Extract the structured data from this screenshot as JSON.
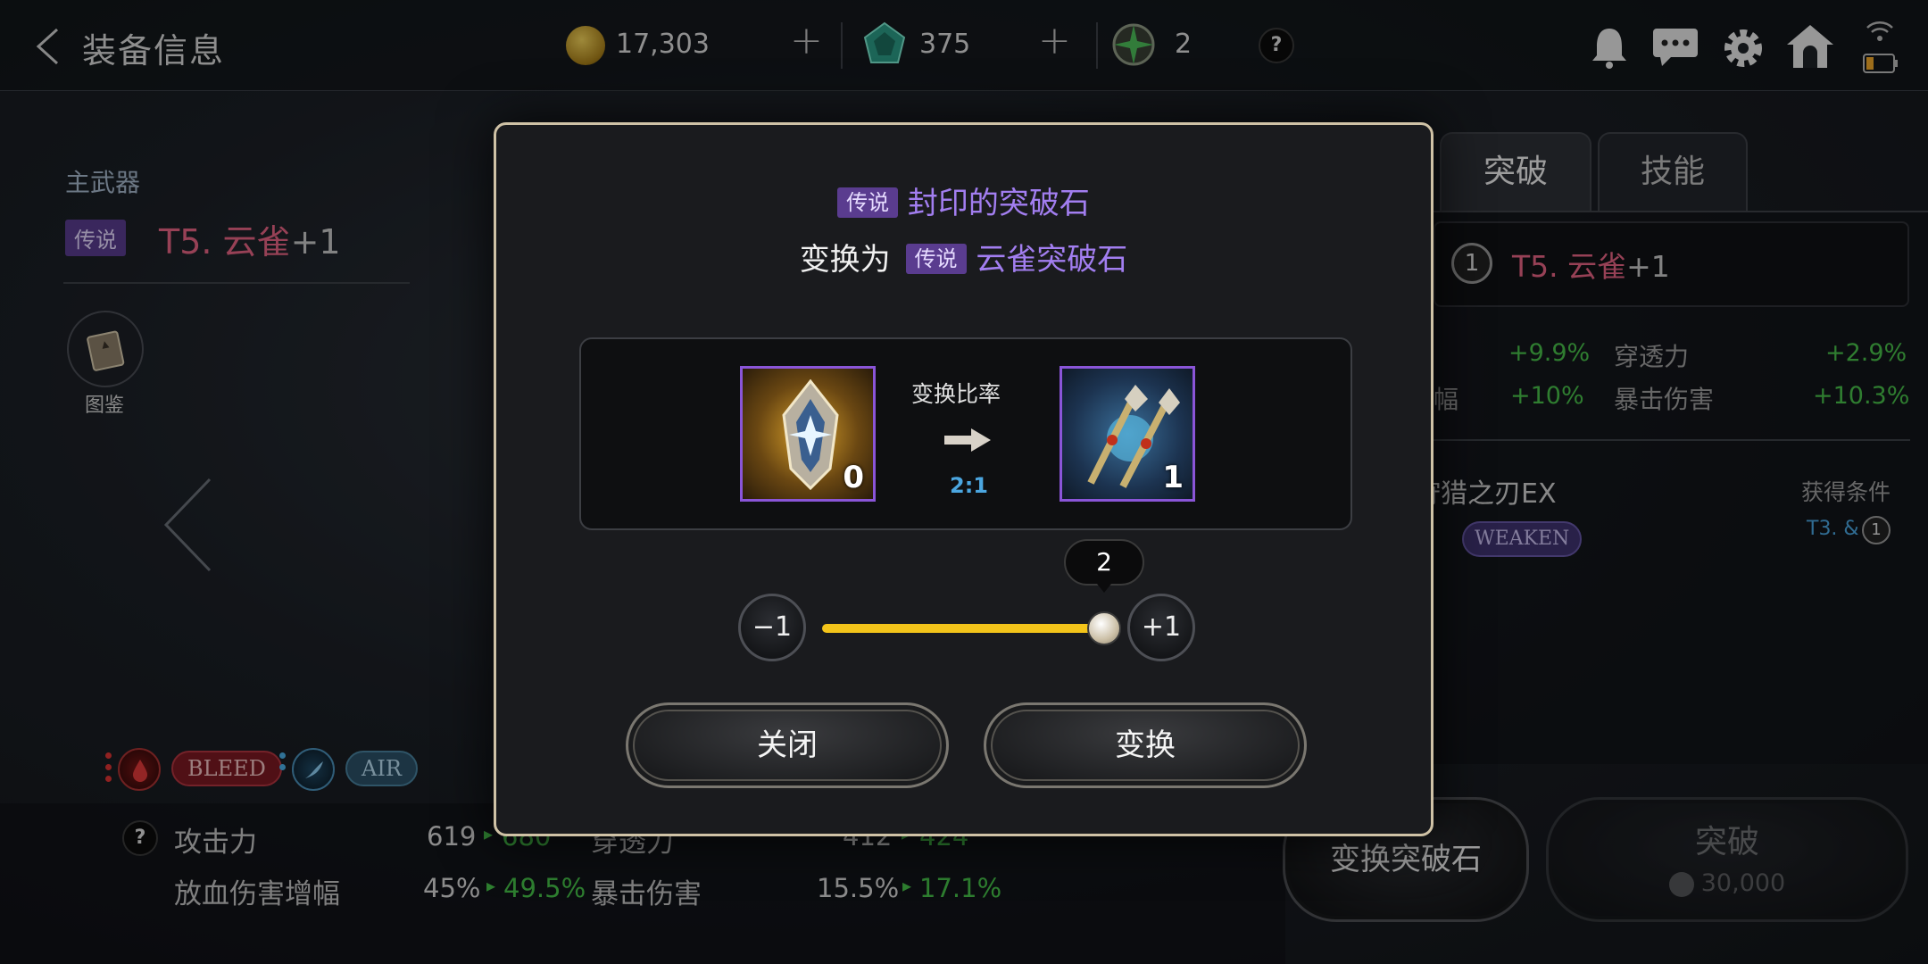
{
  "header": {
    "title": "装备信息",
    "gold": "17,303",
    "gems": "375",
    "tokens": "2",
    "help": "?",
    "plus": "+"
  },
  "left": {
    "slot_label": "主武器",
    "rarity": "传说",
    "weapon_name": "T5. 云雀",
    "weapon_level": "+1",
    "codex_label": "图鉴",
    "chips": [
      "BLEED",
      "AIR"
    ]
  },
  "stats": {
    "help": "?",
    "rows": [
      {
        "label": "攻击力",
        "value": "619",
        "new": "680",
        "label2": "穿透力",
        "value2": "412",
        "new2": "424"
      },
      {
        "label": "放血伤害增幅",
        "value": "45%",
        "new": "49.5%",
        "label2": "暴击伤害",
        "value2": "15.5%",
        "new2": "17.1%"
      }
    ]
  },
  "right": {
    "tabs": [
      "突破",
      "技能"
    ],
    "item_badge": "1",
    "item_name": "T5. 云雀",
    "item_level": "+1",
    "stats": [
      {
        "v1": "+9.9%",
        "label": "穿透力",
        "v2": "+2.9%"
      },
      {
        "label_left": "幅",
        "v1": "+10%",
        "label": "暴击伤害",
        "v2": "+10.3%"
      }
    ],
    "skill_name": "狩猎之刃EX",
    "skill_cond_label": "获得条件",
    "skill_chip": "WEAKEN",
    "cond_value": "T3. &",
    "cond_badge": "1",
    "btn_convert": "变换突破石",
    "btn_break": "突破",
    "break_cost": "30,000"
  },
  "modal": {
    "rarity": "传说",
    "from_name": "封印的突破石",
    "convert_prefix": "变换为",
    "to_name": "云雀突破石",
    "ratio_title": "变换比率",
    "ratio": "2:1",
    "from_count": "0",
    "to_count": "1",
    "minus_label": "−1",
    "plus_label": "+1",
    "quantity": "2",
    "slider_fraction": 1.0,
    "close_label": "关闭",
    "convert_label": "变换"
  }
}
